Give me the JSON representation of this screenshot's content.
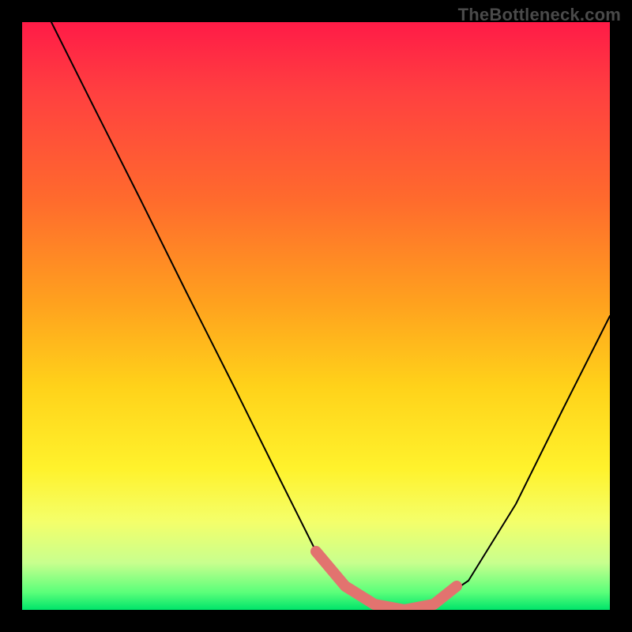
{
  "attribution": "TheBottleneck.com",
  "chart_data": {
    "type": "line",
    "title": "",
    "xlabel": "",
    "ylabel": "",
    "xlim": [
      0,
      1
    ],
    "ylim": [
      0,
      1
    ],
    "series": [
      {
        "name": "curve",
        "color": "#000000",
        "x": [
          0.05,
          0.12,
          0.2,
          0.28,
          0.36,
          0.44,
          0.5,
          0.55,
          0.6,
          0.65,
          0.7,
          0.76,
          0.84,
          0.92,
          1.0
        ],
        "y": [
          1.0,
          0.86,
          0.7,
          0.54,
          0.38,
          0.22,
          0.1,
          0.04,
          0.01,
          0.0,
          0.01,
          0.05,
          0.18,
          0.34,
          0.5
        ]
      },
      {
        "name": "highlight",
        "color": "#e2736f",
        "x": [
          0.5,
          0.55,
          0.6,
          0.65,
          0.7,
          0.74
        ],
        "y": [
          0.1,
          0.04,
          0.01,
          0.0,
          0.01,
          0.04
        ]
      }
    ],
    "gradient_stops": [
      {
        "pos": 0.0,
        "color": "#ff1b47"
      },
      {
        "pos": 0.3,
        "color": "#ff6a2d"
      },
      {
        "pos": 0.62,
        "color": "#ffd21a"
      },
      {
        "pos": 0.85,
        "color": "#f4ff6a"
      },
      {
        "pos": 1.0,
        "color": "#00e46a"
      }
    ]
  }
}
